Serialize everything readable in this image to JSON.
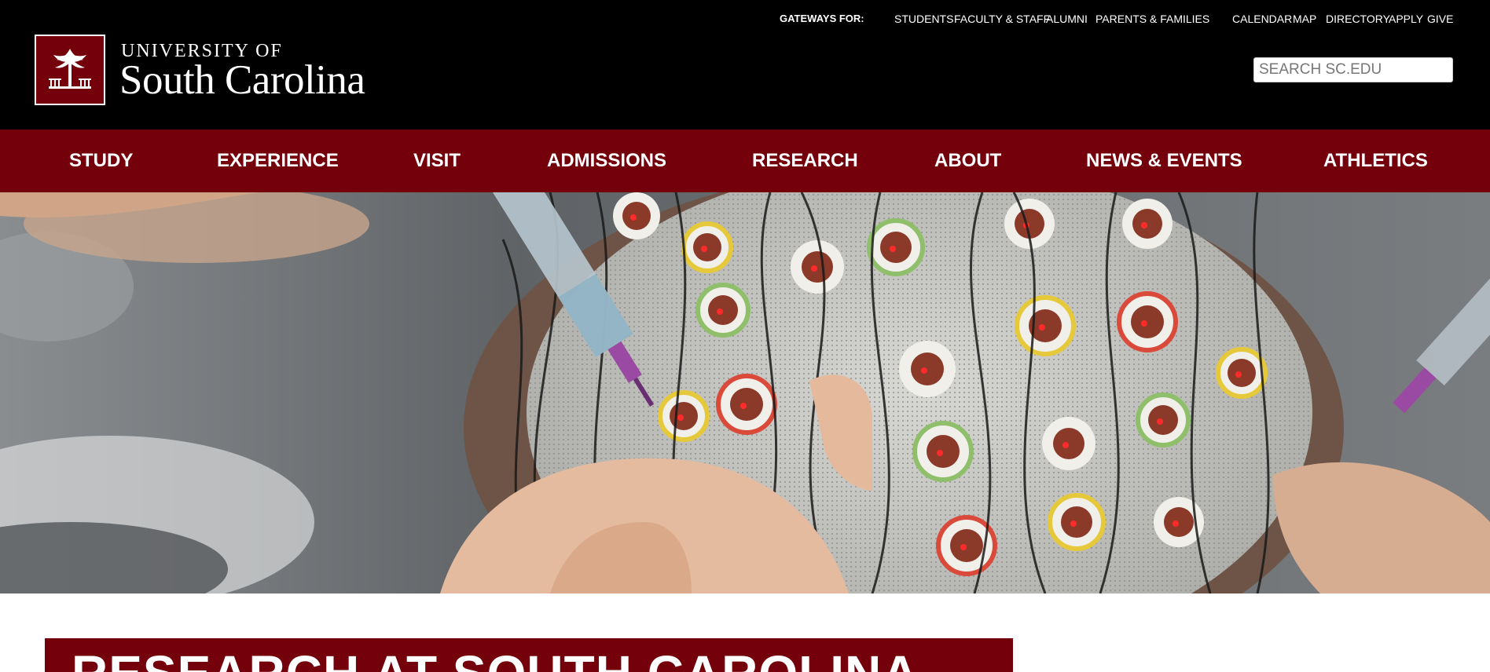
{
  "logo": {
    "line1": "UNIVERSITY OF",
    "line2": "South Carolina",
    "icon": "palmetto-tree-icon"
  },
  "utility": {
    "gateways_label": "GATEWAYS FOR:",
    "gateways": [
      "STUDENTS",
      "FACULTY & STAFF",
      "ALUMNI",
      "PARENTS & FAMILIES"
    ],
    "links": [
      "CALENDAR",
      "MAP",
      "DIRECTORY",
      "APPLY",
      "GIVE"
    ]
  },
  "search": {
    "placeholder": "SEARCH SC.EDU",
    "value": ""
  },
  "nav": {
    "items": [
      "STUDY",
      "EXPERIENCE",
      "VISIT",
      "ADMISSIONS",
      "RESEARCH",
      "ABOUT",
      "NEWS & EVENTS",
      "ATHLETICS"
    ]
  },
  "page": {
    "title": "RESEARCH AT SOUTH CAROLINA"
  },
  "colors": {
    "garnet": "#73000a",
    "header_black": "#000000",
    "text_white": "#ffffff"
  }
}
